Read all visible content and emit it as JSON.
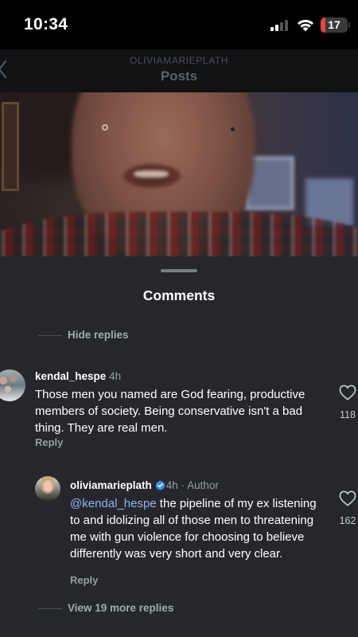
{
  "status_bar": {
    "time": "10:34",
    "battery_level": "17",
    "battery_color": "#e5463f"
  },
  "header": {
    "username": "OLIVIAMARIEPLATH",
    "title": "Posts",
    "back_icon": "chevron-left-icon"
  },
  "comments_sheet": {
    "title": "Comments",
    "hide_replies_label": "Hide replies",
    "view_more_label": "View 19 more replies",
    "mention_color": "#8eb4f2",
    "comments": [
      {
        "username": "kendal_hespe",
        "time": "4h",
        "text": "Those men you named are God fearing, productive members of society. Being conservative isn't a bad thing. They are real men.",
        "reply_label": "Reply",
        "like_count": "118"
      },
      {
        "username": "oliviamarieplath",
        "time": "4h",
        "author_badge": " · Author",
        "verified_icon": "verified-badge-icon",
        "mention": "@kendal_hespe",
        "text": " the pipeline of my ex listening to and idolizing all of those men to threatening me with gun violence for choosing to believe differently was very short and very clear.",
        "reply_label": "Reply",
        "like_count": "162"
      }
    ]
  }
}
